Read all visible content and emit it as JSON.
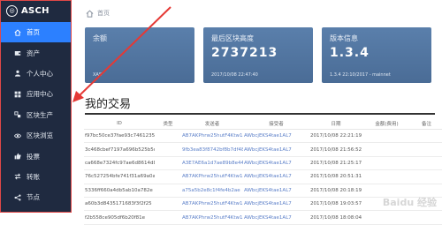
{
  "app": {
    "logo_text": "ASCH"
  },
  "sidebar": {
    "items": [
      {
        "label": "首页",
        "icon": "home-icon",
        "active": true
      },
      {
        "label": "资产",
        "icon": "wallet-icon",
        "active": false
      },
      {
        "label": "个人中心",
        "icon": "person-icon",
        "active": false
      },
      {
        "label": "应用中心",
        "icon": "apps-icon",
        "active": false
      },
      {
        "label": "区块生产",
        "icon": "blocks-icon",
        "active": false
      },
      {
        "label": "区块浏览",
        "icon": "eye-icon",
        "active": false
      },
      {
        "label": "投票",
        "icon": "thumbs-up-icon",
        "active": false
      },
      {
        "label": "转账",
        "icon": "transfer-icon",
        "active": false
      },
      {
        "label": "节点",
        "icon": "share-icon",
        "active": false
      }
    ]
  },
  "breadcrumb": {
    "label": "首页"
  },
  "cards": [
    {
      "label": "余额",
      "value": "",
      "foot": "XAS"
    },
    {
      "label": "最后区块高度",
      "value": "2737213",
      "foot": "2017/10/08 22:47:40"
    },
    {
      "label": "版本信息",
      "value": "1.3.4",
      "foot": "1.3.4 22:10/2017 - mainnet"
    }
  ],
  "transactions": {
    "title": "我的交易",
    "columns": [
      "ID",
      "类型",
      "发送者",
      "接受者",
      "日期",
      "金额(费用)",
      "备注"
    ],
    "rows": [
      {
        "id": "f97bc50ce37fae93c7461235906",
        "type": "",
        "from": "AB7AKPhrw25hutF4Ktw1aa1",
        "to": "AWbcjEKS4tae1AL7",
        "date": "2017/10/08 22:21:19",
        "fee": "",
        "note": ""
      },
      {
        "id": "3c468cbef7197a696b525b5dac",
        "type": "",
        "from": "9fb3ea83f8742bf8b7df48",
        "to": "AWbcjEKS4tae1AL7",
        "date": "2017/10/08 21:56:52",
        "fee": "",
        "note": ""
      },
      {
        "id": "ca668e7324fc97ae6d8614d8",
        "type": "",
        "from": "A3E7AE6a1d7ae89b8e44f5",
        "to": "AWbcjEKS4tae1AL7",
        "date": "2017/10/08 21:25:17",
        "fee": "",
        "note": ""
      },
      {
        "id": "76c527254bfe741f31a69a0a",
        "type": "",
        "from": "AB7AKPhrw25hutF4Ktw1aa1",
        "to": "AWbcjEKS4tae1AL7",
        "date": "2017/10/08 20:51:31",
        "fee": "",
        "note": ""
      },
      {
        "id": "5336ff660a4db5ab10a782e",
        "type": "",
        "from": "a75a5b2e8c1f4fe4b2ae",
        "to": "AWbcjEKS4tae1AL7",
        "date": "2017/10/08 20:18:19",
        "fee": "",
        "note": ""
      },
      {
        "id": "a60b3d8435171683f3f2f25",
        "type": "",
        "from": "AB7AKPhrw25hutF4Ktw1aa1",
        "to": "AWbcjEKS4tae1AL7",
        "date": "2017/10/08 19:03:57",
        "fee": "",
        "note": ""
      },
      {
        "id": "f2b558ce905df6b20f81e",
        "type": "",
        "from": "AB7AKPhrw25hutF4Ktw1aa1",
        "to": "AWbcjEKS4tae1AL7",
        "date": "2017/10/08 18:08:04",
        "fee": "",
        "note": ""
      }
    ]
  },
  "watermark": "Baidu 经验"
}
